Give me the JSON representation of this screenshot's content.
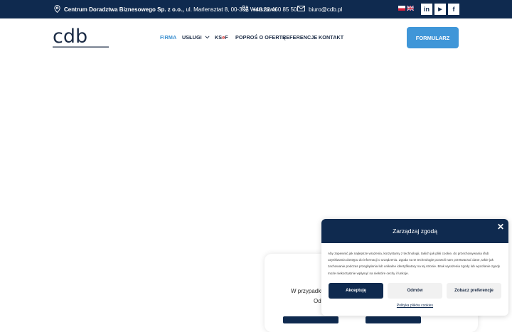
{
  "topbar": {
    "company_name": "Centrum Doradztwa Biznesowego Sp. z o.o.,",
    "address": "ul. Marlensztat 8, 00-302 Warszawa",
    "phone": "+48 22 460 85 50",
    "email": "biuro@cdb.pl",
    "social": [
      "in",
      "▶",
      "f"
    ]
  },
  "header": {
    "logo_text": "cdb",
    "nav": [
      {
        "label": "FIRMA",
        "active": true
      },
      {
        "label": "USŁUGI",
        "has_dropdown": true
      },
      {
        "label_k": "KS",
        "label_e": "e",
        "label_f": "F"
      },
      {
        "label": "POPROŚ O OFERTĘ"
      },
      {
        "label": "REFERENCJE"
      },
      {
        "label": "KONTAKT"
      }
    ],
    "cta_label": "FORMULARZ"
  },
  "card": {
    "line1": "W przypadku p",
    "line2": "Ode"
  },
  "cookie": {
    "title": "Zarządzaj zgodą",
    "text": "Aby zapewnić jak najlepsze wrażenia, korzystamy z technologii, takich jak pliki cookie, do przechowywania i/lub uzyskiwania dostępu do informacji o urządzeniu. Zgoda na te technologie pozwoli nam przetwarzać dane, takie jak zachowanie podczas przeglądania lub unikalne identyfikatory na tej stronie. Brak wyrażenia zgody lub wycofanie zgody może niekorzystnie wpłynąć na niektóre cechy i funkcje.",
    "accept_label": "Akceptuję",
    "deny_label": "Odmów",
    "prefs_label": "Zobacz preferencje",
    "policy_link": "Polityka plików cookies"
  },
  "colors": {
    "navy": "#0f2a4f",
    "accent_blue": "#3f96d8",
    "active_nav": "#3a8fd0",
    "ksef_red": "#d22b2b"
  }
}
